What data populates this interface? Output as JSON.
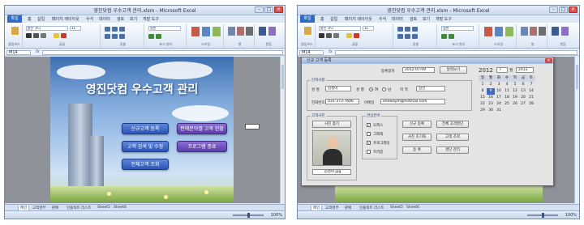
{
  "left_window": {
    "title": "영진닷컴 우수고객 관리.xlsm - Microsoft Excel",
    "window_buttons": [
      "–",
      "□",
      "×"
    ],
    "tabs": [
      "파일",
      "홈",
      "삽입",
      "페이지 레이아웃",
      "수식",
      "데이터",
      "검토",
      "보기",
      "개발 도구"
    ],
    "font_name": "맑은 고딕",
    "font_size": "11",
    "number_format": "일반",
    "name_box": "M14",
    "fx": "fx",
    "ribbon_groups": [
      "클립보드",
      "글꼴",
      "맞춤",
      "표시 형식",
      "스타일",
      "셀",
      "편집"
    ],
    "app_title": "영진닷컴 우수고객 관리",
    "menu": {
      "register": "신규고객 등록",
      "analysis": "판매분야별 고객 현황",
      "search": "고객 검색 및 수정",
      "exit": "프로그램 종료",
      "list": "전체고객 조회"
    },
    "sheet_tabs": [
      "메인",
      "고객명부",
      "판매",
      "인플렉트 리스트",
      "Sheet5",
      "Sheet6"
    ],
    "zoom": "100%"
  },
  "right_window": {
    "title": "영진닷컴 우수고객 관리.xlsm - Microsoft Excel",
    "window_buttons": [
      "–",
      "□",
      "×"
    ],
    "tabs": [
      "파일",
      "홈",
      "삽입",
      "페이지 레이아웃",
      "수식",
      "데이터",
      "검토",
      "보기",
      "개발 도구"
    ],
    "font_name": "맑은 고딕",
    "font_size": "11",
    "number_format": "일반",
    "name_box": "M14",
    "fx": "fx",
    "ribbon_groups": [
      "클립보드",
      "글꼴",
      "맞춤",
      "표시 형식",
      "스타일",
      "셀",
      "편집"
    ],
    "sheet_tabs": [
      "메인",
      "고객명부",
      "판매",
      "인플렉트 리스트",
      "Sheet5",
      "Sheet6"
    ],
    "zoom": "100%",
    "dialog": {
      "title": "신규 고객 등록",
      "close": "×",
      "date_label": "등록일자",
      "date_value": "2012-07-09",
      "calendar_button": "달력보기",
      "personal_caption": "인적사항",
      "name_label": "성 명",
      "name_value": "김성아",
      "gender_label": "성 별",
      "gender_female": "여",
      "gender_male": "남",
      "region_label": "지 역",
      "region_value": "일산",
      "phone_label": "전화번호",
      "phone_value": "031-373-7606",
      "email_label": "이메일",
      "email_value": "onewaym@hotmail.com",
      "photo_caption": "고객사진",
      "photo_button": "사진 찾기",
      "photo_filename": "김성아.jpg",
      "interest_caption": "관심분야",
      "interests": [
        {
          "label": "오피스",
          "checked": true
        },
        {
          "label": "그래픽",
          "checked": false
        },
        {
          "label": "프로그래밍",
          "checked": true
        },
        {
          "label": "자격증",
          "checked": false
        }
      ],
      "actions": {
        "new": "신규 등록",
        "all_list": "전체 고객명단",
        "photo_delete": "사진 초기화",
        "search": "고객 조회",
        "ok": "등 록",
        "list": "명단 관리"
      },
      "calendar": {
        "year": "2012",
        "month": "7",
        "month_label": "월",
        "year_label": "2012",
        "weekdays": [
          "일",
          "월",
          "화",
          "수",
          "목",
          "금",
          "토"
        ],
        "days": [
          "1",
          "2",
          "3",
          "4",
          "5",
          "6",
          "7",
          "8",
          "9",
          "10",
          "11",
          "12",
          "13",
          "14",
          "15",
          "16",
          "17",
          "18",
          "19",
          "20",
          "21",
          "22",
          "23",
          "24",
          "25",
          "26",
          "27",
          "28",
          "29",
          "30",
          "31"
        ],
        "selected": "9"
      }
    }
  },
  "colors": {
    "excel_blue": "#2e6bc4",
    "menu_blue": "#2c55b5",
    "menu_purple": "#5b3ea8",
    "calendar_selected": "#3d6ac0"
  }
}
